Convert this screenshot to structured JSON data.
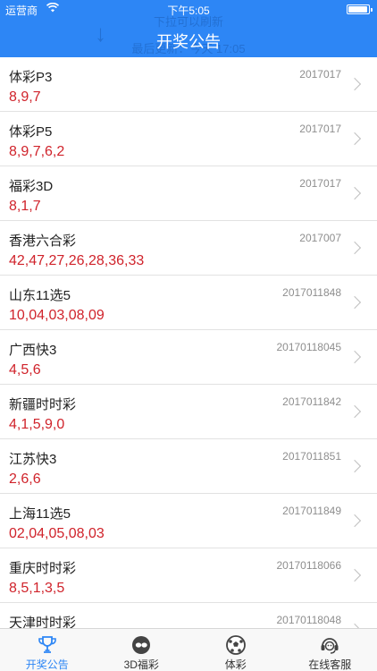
{
  "status_bar": {
    "carrier": "运营商",
    "time": "下午5:05"
  },
  "header": {
    "title": "开奖公告",
    "refresh_hint": "下拉可以刷新",
    "refresh_last": "最后更新：今天 17:05"
  },
  "lotteries": [
    {
      "name": "体彩P3",
      "issue": "2017017",
      "numbers": "8,9,7"
    },
    {
      "name": "体彩P5",
      "issue": "2017017",
      "numbers": "8,9,7,6,2"
    },
    {
      "name": "福彩3D",
      "issue": "2017017",
      "numbers": "8,1,7"
    },
    {
      "name": "香港六合彩",
      "issue": "2017007",
      "numbers": "42,47,27,26,28,36,33"
    },
    {
      "name": "山东11选5",
      "issue": "2017011848",
      "numbers": "10,04,03,08,09"
    },
    {
      "name": "广西快3",
      "issue": "20170118045",
      "numbers": "4,5,6"
    },
    {
      "name": "新疆时时彩",
      "issue": "2017011842",
      "numbers": "4,1,5,9,0"
    },
    {
      "name": "江苏快3",
      "issue": "2017011851",
      "numbers": "2,6,6"
    },
    {
      "name": "上海11选5",
      "issue": "2017011849",
      "numbers": "02,04,05,08,03"
    },
    {
      "name": "重庆时时彩",
      "issue": "20170118066",
      "numbers": "8,5,1,3,5"
    },
    {
      "name": "天津时时彩",
      "issue": "20170118048",
      "numbers": ""
    }
  ],
  "tabs": [
    {
      "label": "开奖公告",
      "icon": "trophy-icon",
      "active": true
    },
    {
      "label": "3D福彩",
      "icon": "3d-ball-icon",
      "active": false
    },
    {
      "label": "体彩",
      "icon": "soccer-ball-icon",
      "active": false
    },
    {
      "label": "在线客服",
      "icon": "headset-icon",
      "active": false
    }
  ],
  "colors": {
    "accent": "#2d86f5",
    "numbers": "#d0232b",
    "tab_active": "#2d86f5"
  }
}
